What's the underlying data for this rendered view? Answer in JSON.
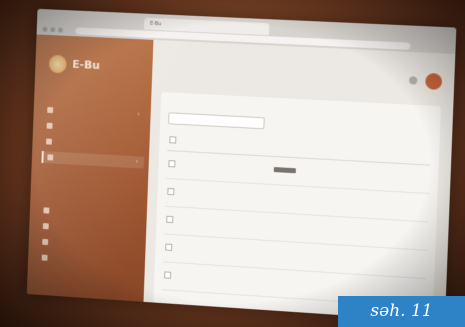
{
  "browser": {
    "tab_title": "E-Bu",
    "address": "",
    "tab_icon": "page-icon"
  },
  "sidebar": {
    "logo_text": "E-Bu",
    "items": [
      {
        "label": "",
        "icon": "grid-icon",
        "chevron": "›"
      },
      {
        "label": "",
        "icon": "doc-icon"
      },
      {
        "label": "",
        "icon": "user-icon"
      },
      {
        "label": "",
        "icon": "file-icon",
        "chevron": "›",
        "active": true
      },
      {
        "label": "",
        "icon": "settings-icon"
      },
      {
        "label": "",
        "icon": "users-icon"
      },
      {
        "label": "",
        "icon": "chat-icon"
      },
      {
        "label": "",
        "icon": "info-icon"
      }
    ]
  },
  "main": {
    "breadcrumb": [
      "",
      ""
    ],
    "card_title": "",
    "filter_value": "",
    "table": {
      "headers": [
        "",
        "",
        "",
        "",
        "",
        "",
        "",
        ""
      ],
      "rows": [
        [
          "",
          "",
          "",
          "",
          "",
          "",
          "",
          ""
        ],
        [
          "",
          "",
          "",
          "",
          "",
          "",
          "",
          ""
        ],
        [
          "",
          "",
          "",
          "",
          "",
          "",
          "",
          ""
        ],
        [
          "",
          "",
          "",
          "",
          "",
          "",
          "",
          ""
        ],
        [
          "",
          "",
          "",
          "",
          "",
          "",
          "",
          ""
        ],
        [
          "",
          "",
          "",
          "",
          "",
          "",
          "",
          ""
        ]
      ]
    },
    "bottom_button": ""
  },
  "caption": {
    "text": "səh. 11",
    "background": "#2d83c6"
  },
  "colors": {
    "sidebar": "#a95f35",
    "accent_avatar": "#c8653a"
  }
}
